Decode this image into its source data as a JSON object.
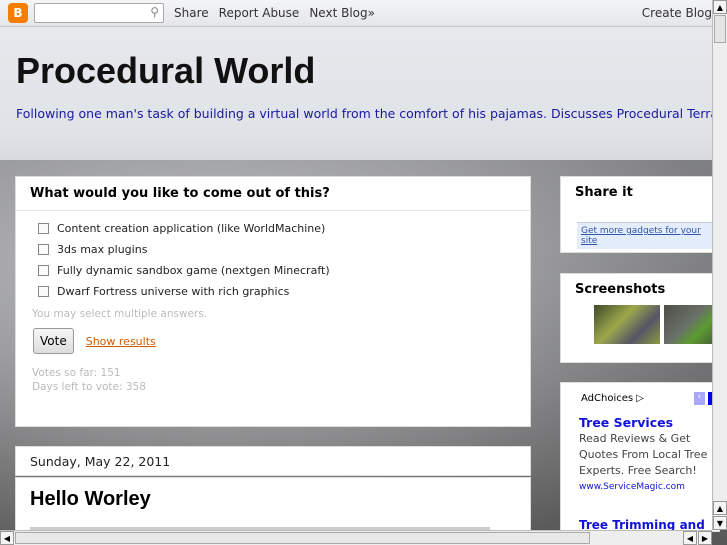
{
  "navbar": {
    "search_placeholder": "",
    "links": [
      "Share",
      "Report Abuse",
      "Next Blog»"
    ],
    "create": "Create Blog"
  },
  "blog": {
    "title": "Procedural World",
    "description": "Following one man's task of building a virtual world from the comfort of his pajamas. Discusses Procedural Terrain, Vegetation and Architecture generation. Also OpenCL, Voxels and Computer Graphics in general."
  },
  "poll": {
    "question": "What would you like to come out of this?",
    "options": [
      "Content creation application (like WorldMachine)",
      "3ds max plugins",
      "Fully dynamic sandbox game (nextgen Minecraft)",
      "Dwarf Fortress universe with rich graphics"
    ],
    "hint": "You may select multiple answers.",
    "vote": "Vote",
    "show_results": "Show results",
    "votes": "Votes so far: 151",
    "days_left": "Days left to vote: 358"
  },
  "post": {
    "date": "Sunday, May 22, 2011",
    "title": "Hello Worley"
  },
  "sidebar": {
    "share_title": "Share it",
    "gadgets_link": "Get more gadgets for your site",
    "screenshots_title": "Screenshots",
    "adchoices": "AdChoices",
    "ad1": {
      "title": "Tree Services",
      "body": "Read Reviews & Get Quotes From Local Tree Experts. Free Search!",
      "url": "www.ServiceMagic.com"
    },
    "ad2_title": "Tree Trimming and"
  }
}
